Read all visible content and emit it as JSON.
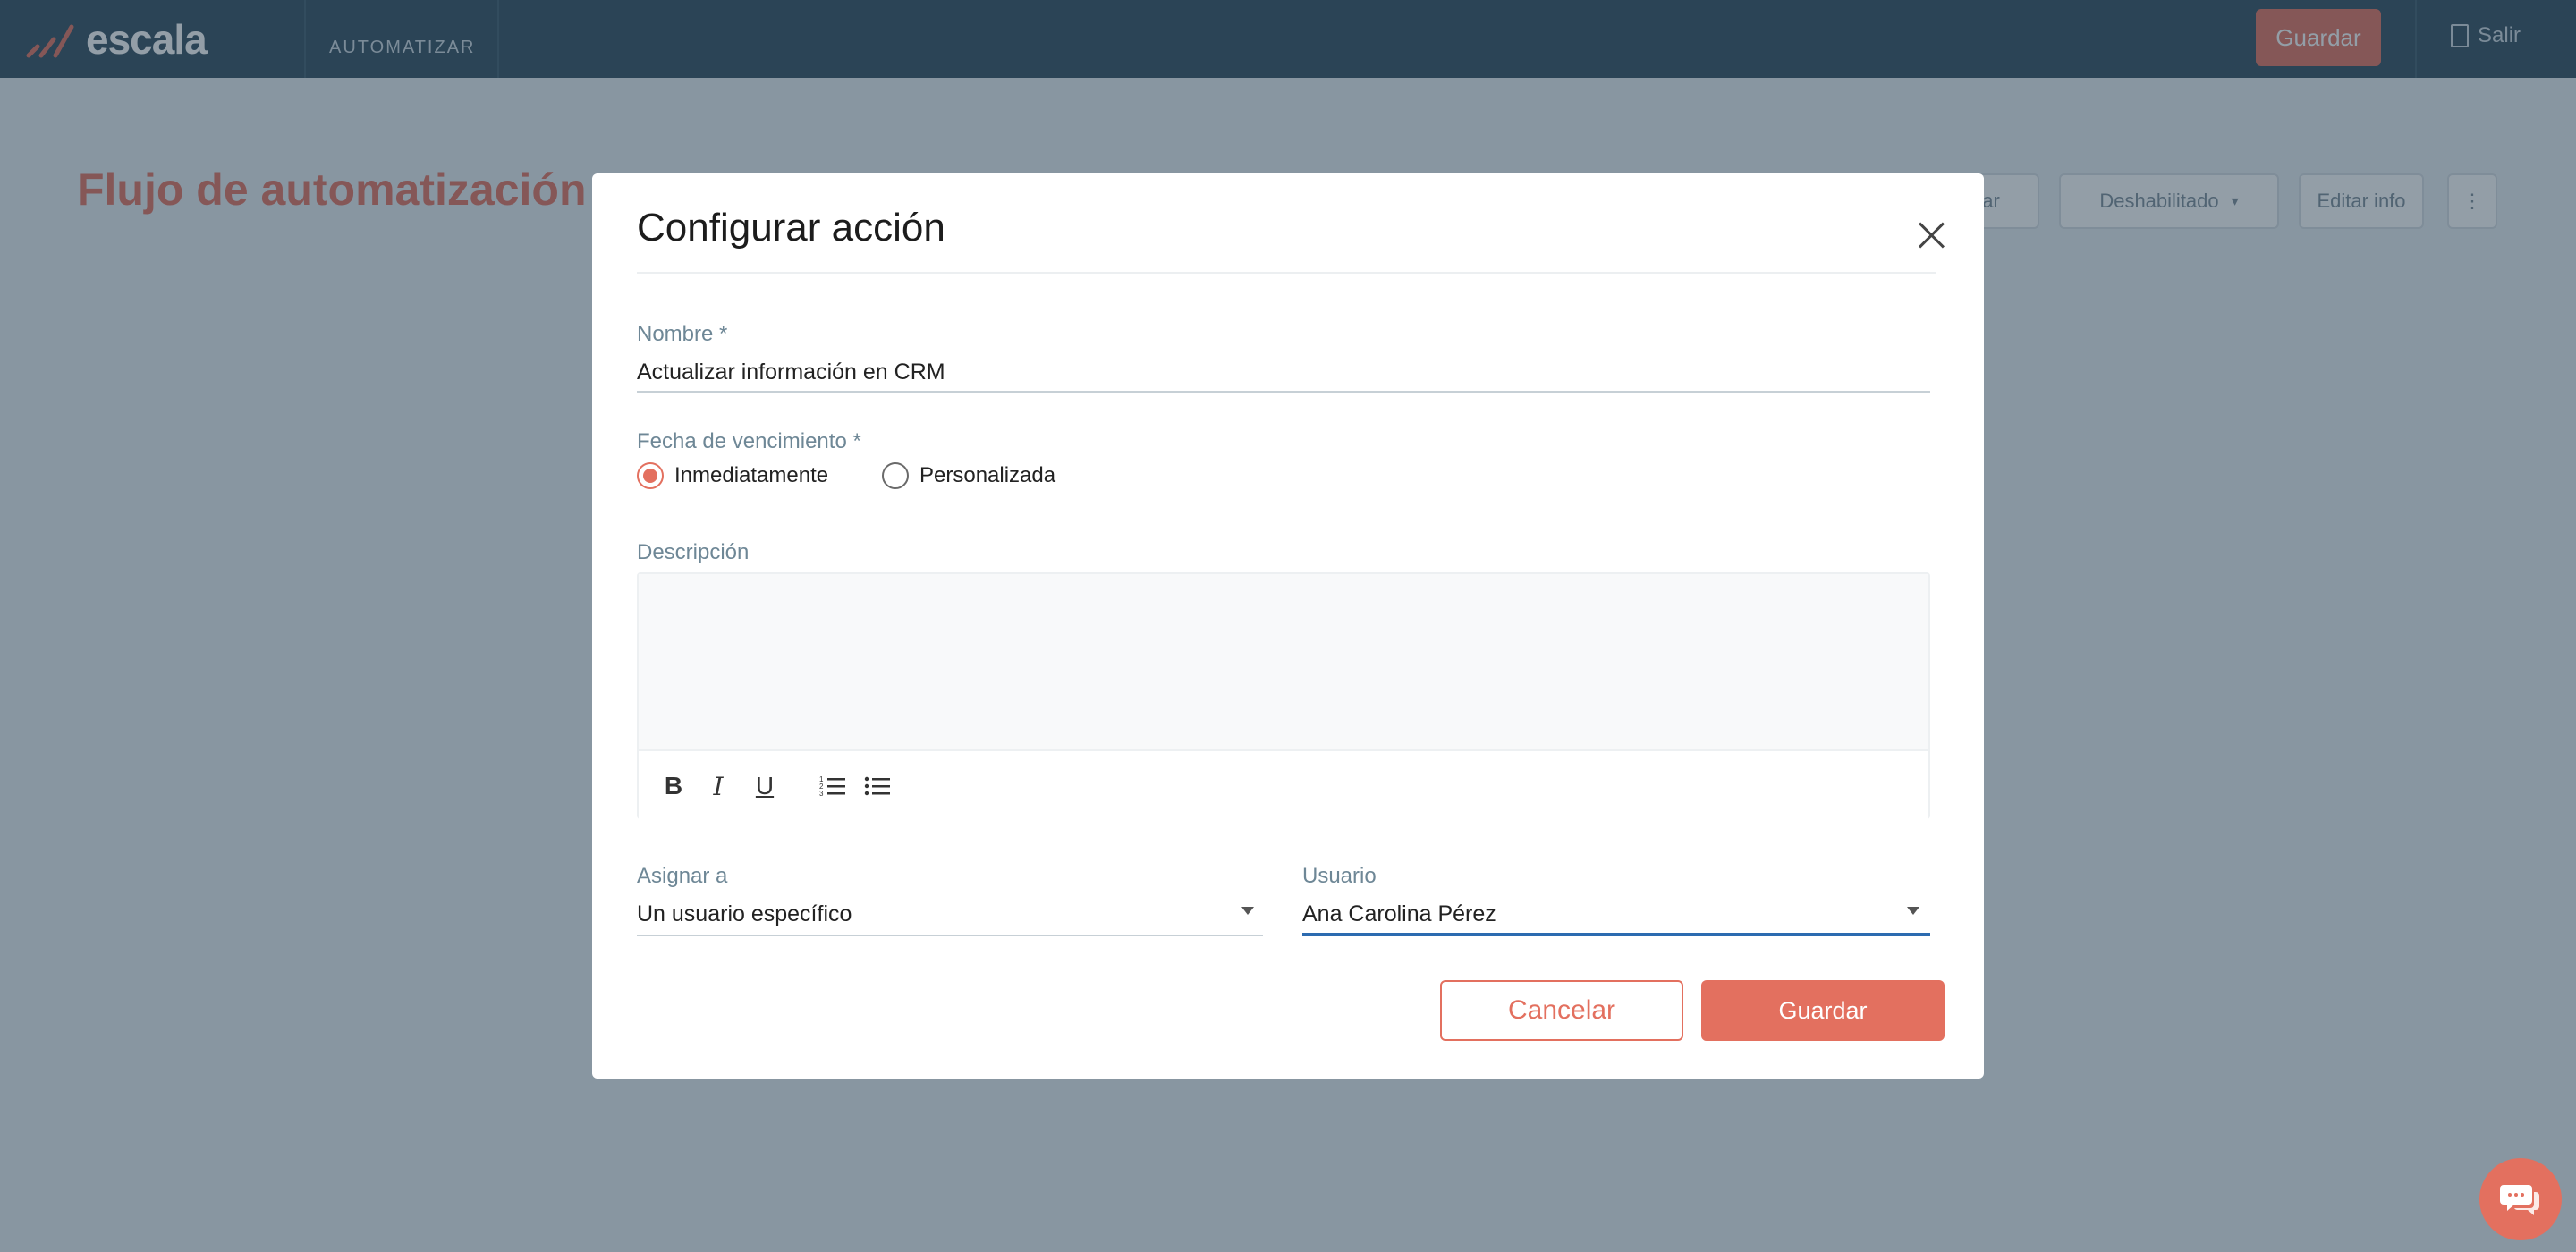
{
  "app": {
    "logo_text": "escala",
    "nav_item": "AUTOMATIZAR",
    "save_label": "Guardar",
    "logout_label": "Salir"
  },
  "page": {
    "title": "Flujo de automatización",
    "btn_a": "…ar",
    "btn_status": "Deshabilitado",
    "btn_edit": "Editar info",
    "btn_more": "⋮"
  },
  "modal": {
    "title": "Configurar acción",
    "name_label": "Nombre *",
    "name_value": "Actualizar información en CRM",
    "due_label": "Fecha de vencimiento *",
    "due_options": [
      "Inmediatamente",
      "Personalizada"
    ],
    "due_selected": "Inmediatamente",
    "desc_label": "Descripción",
    "toolbar": {
      "bold": "B",
      "italic": "I",
      "underline": "U",
      "ordered_list": "≔",
      "bullet_list": "☰"
    },
    "assign_label": "Asignar a",
    "assign_value": "Un usuario específico",
    "user_label": "Usuario",
    "user_value": "Ana Carolina Pérez",
    "cancel_label": "Cancelar",
    "save_label": "Guardar"
  },
  "colors": {
    "accent": "#e3705f",
    "topbar": "#2e4a5c",
    "focus": "#2c6bb0"
  }
}
